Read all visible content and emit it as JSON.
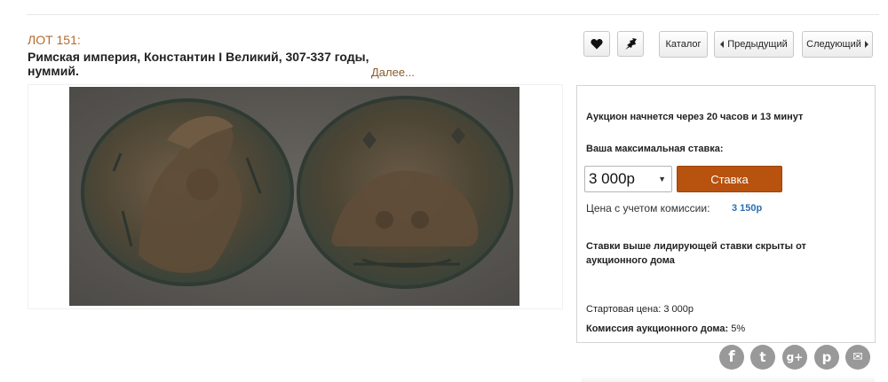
{
  "lot": {
    "number_label": "ЛОТ 151:",
    "title": "Римская империя, Константин I Великий, 307-337 годы, нуммий.",
    "more_link": "Далее..."
  },
  "toolbar": {
    "favorite_icon": "heart-icon",
    "watch_icon": "bird-icon",
    "catalog_label": "Каталог",
    "prev_label": "Предыдущий",
    "next_label": "Следующий"
  },
  "image": {
    "description_icon": "coin-photo"
  },
  "bid_panel": {
    "timer_text": "Аукцион начнется через 20 часов и 13 минут",
    "max_bid_label": "Ваша максимальная ставка:",
    "bid_value": "3 000р",
    "bid_button_label": "Ставка",
    "commission_price_label": "Цена с учетом комиссии:",
    "commission_price_value": "3 150р",
    "hidden_note": "Ставки выше лидирующей ставки скрыты от аукционного дома",
    "start_price_label": "Стартовая цена:",
    "start_price_value": "3 000р",
    "fee_label": "Комиссия аукционного дома:",
    "fee_value": "5%"
  },
  "social": [
    {
      "name": "facebook-icon",
      "glyph": "f"
    },
    {
      "name": "twitter-icon",
      "glyph": "t"
    },
    {
      "name": "google-plus-icon",
      "glyph": "g+"
    },
    {
      "name": "pinterest-icon",
      "glyph": "p"
    },
    {
      "name": "email-icon",
      "glyph": "✉"
    }
  ],
  "colors": {
    "accent": "#b8520f",
    "lot_label": "#b36a2c",
    "link_blue": "#2a6fb0",
    "social_gray": "#999999"
  }
}
